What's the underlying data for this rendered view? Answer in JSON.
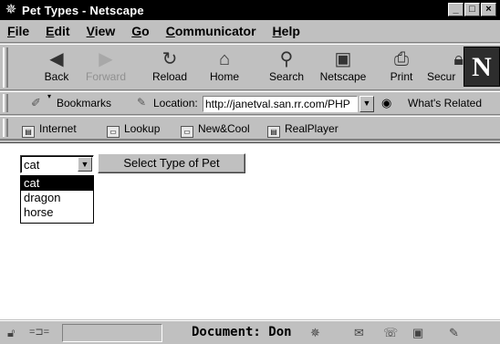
{
  "window": {
    "title": "Pet Types - Netscape",
    "minimize": "_",
    "maximize": "□",
    "close": "×"
  },
  "menubar": {
    "items": [
      {
        "key": "F",
        "rest": "ile"
      },
      {
        "key": "E",
        "rest": "dit"
      },
      {
        "key": "V",
        "rest": "iew"
      },
      {
        "key": "G",
        "rest": "o"
      },
      {
        "key": "C",
        "rest": "ommunicator"
      },
      {
        "key": "H",
        "rest": "elp"
      }
    ]
  },
  "navbar": {
    "back": "Back",
    "forward": "Forward",
    "reload": "Reload",
    "home": "Home",
    "search": "Search",
    "netscape": "Netscape",
    "print": "Print",
    "security": "Secur",
    "logo": "N"
  },
  "location": {
    "bookmarks": "Bookmarks",
    "label": "Location:",
    "url": "http://janetval.san.rr.com/PHP",
    "whats_related": "What's Related"
  },
  "personal": {
    "items": [
      "Internet",
      "Lookup",
      "New&Cool",
      "RealPlayer"
    ]
  },
  "form": {
    "selected": "cat",
    "options": [
      "cat",
      "dragon",
      "horse"
    ],
    "submit_label": "Select Type of Pet"
  },
  "status": {
    "document_text": "Document: Don"
  },
  "icons": {
    "app": "netscape-icon",
    "back": "back-arrow-icon",
    "forward": "forward-arrow-icon",
    "reload": "reload-icon",
    "home": "home-icon",
    "search": "search-icon",
    "netscape": "netscape-my-icon",
    "print": "print-icon",
    "security": "lock-icon"
  }
}
